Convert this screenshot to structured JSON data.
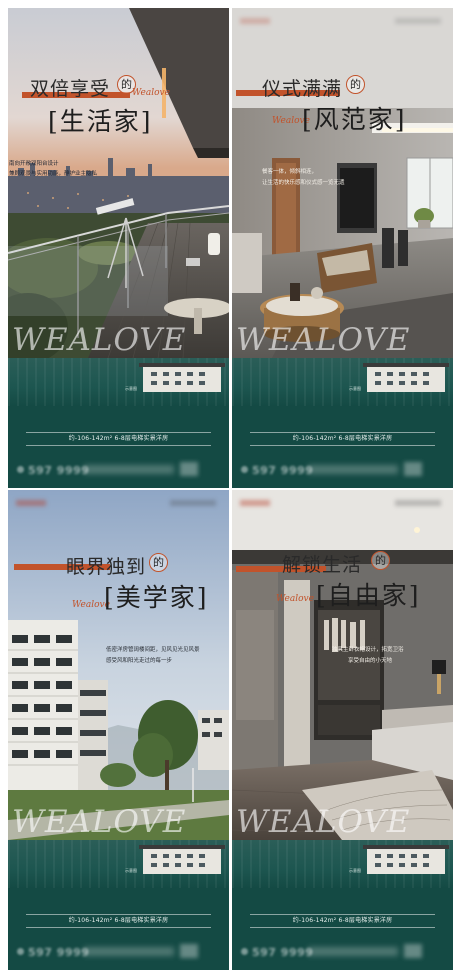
{
  "watermark": "WEALOVE",
  "script_word": "Wealove",
  "de": "的",
  "spec_text": "约-106-142m² 6-8层电梯实景洋房",
  "phone_text": "597 9999",
  "brand_mini": "示意图",
  "colors": {
    "accent": "#c2532b",
    "teal": "#144a44"
  },
  "posters": [
    {
      "title_line1": "双倍享受",
      "title_line2": "[生活家]",
      "desc": [
        "南向开敞双阳台设计",
        "兼顾观景与实用功能，静护业主隐私"
      ]
    },
    {
      "title_line1": "仪式满满",
      "title_line2": "[风范家]",
      "desc": [
        "餐客一体，倾斜相连，",
        "让生活的快乐感和仪式感一览无遗"
      ]
    },
    {
      "title_line1": "眼界独到",
      "title_line2": "[美学家]",
      "desc": [
        "低密洋房管阔楼间距，见风见光见风景",
        "感受风和阳光走过的每一步"
      ]
    },
    {
      "title_line1": "解锁生活",
      "title_line2": "[自由家]",
      "desc": [
        "独具主卧衣帽设计，拓宽卫浴",
        "享受自由的小天地"
      ]
    }
  ]
}
